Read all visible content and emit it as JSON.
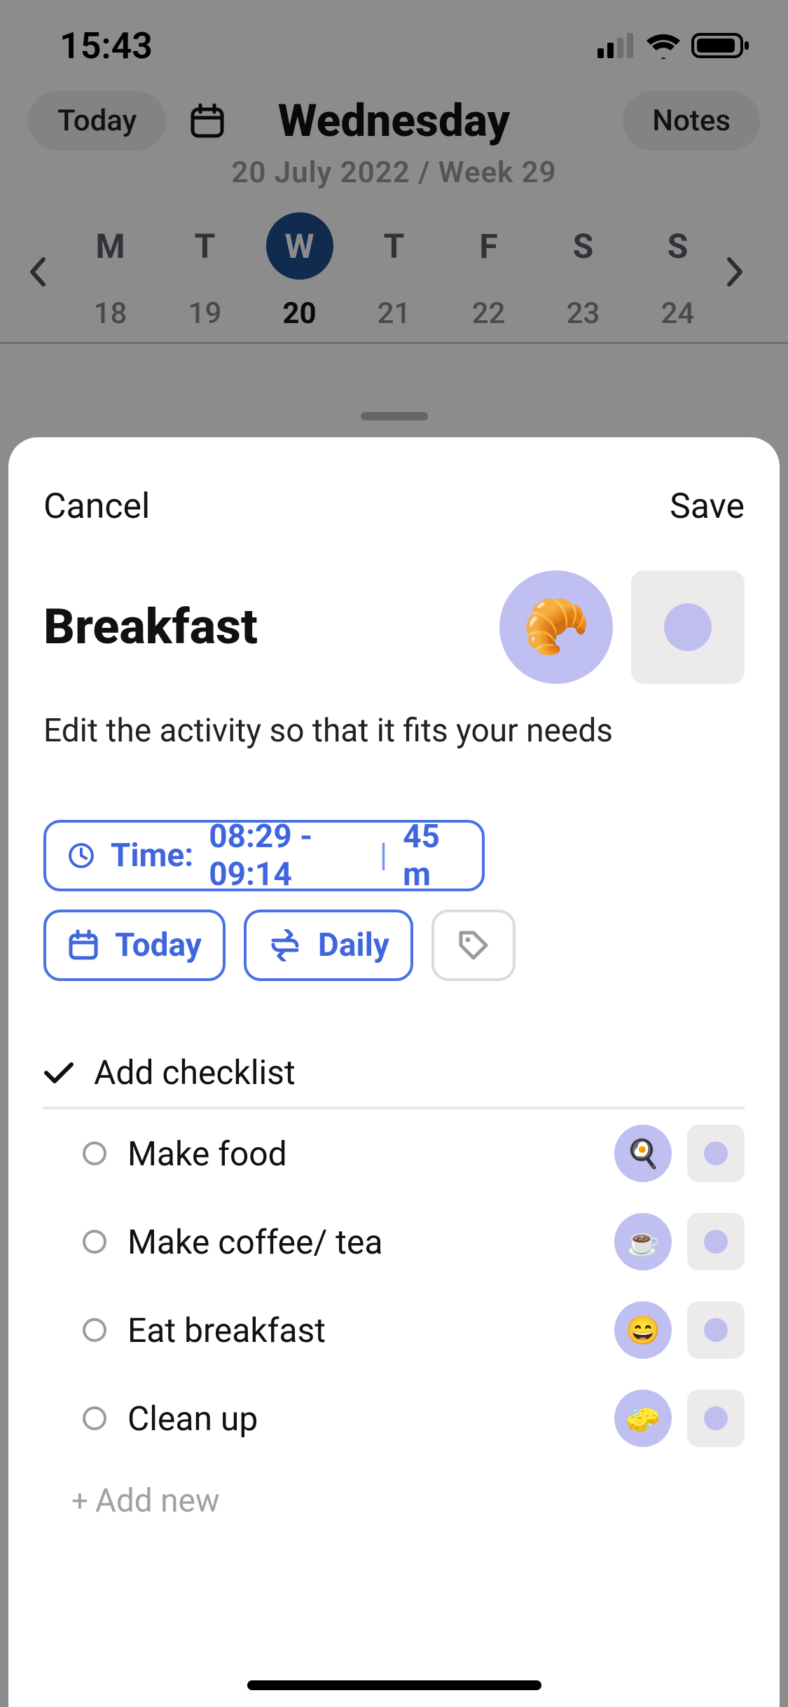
{
  "status": {
    "time": "15:43"
  },
  "header": {
    "today_btn": "Today",
    "notes_btn": "Notes",
    "day_name": "Wednesday",
    "sub_date": "20 July 2022 / Week 29"
  },
  "week": {
    "days": [
      {
        "initial": "M",
        "num": "18"
      },
      {
        "initial": "T",
        "num": "19"
      },
      {
        "initial": "W",
        "num": "20",
        "selected": true
      },
      {
        "initial": "T",
        "num": "21"
      },
      {
        "initial": "F",
        "num": "22"
      },
      {
        "initial": "S",
        "num": "23"
      },
      {
        "initial": "S",
        "num": "24"
      }
    ]
  },
  "sheet": {
    "cancel": "Cancel",
    "save": "Save",
    "title": "Breakfast",
    "icon_emoji": "🥐",
    "description": "Edit the activity so that it fits your needs",
    "time_chip": {
      "label": "Time:",
      "range": "08:29 - 09:14",
      "sep": "|",
      "duration": "45 m"
    },
    "today_chip": "Today",
    "daily_chip": "Daily",
    "checklist_header": "Add checklist",
    "items": [
      {
        "text": "Make food",
        "emoji": "🍳"
      },
      {
        "text": "Make coffee/ tea",
        "emoji": "☕"
      },
      {
        "text": "Eat breakfast",
        "emoji": "😄"
      },
      {
        "text": "Clean up",
        "emoji": "🧽"
      }
    ],
    "add_new": "Add new"
  }
}
